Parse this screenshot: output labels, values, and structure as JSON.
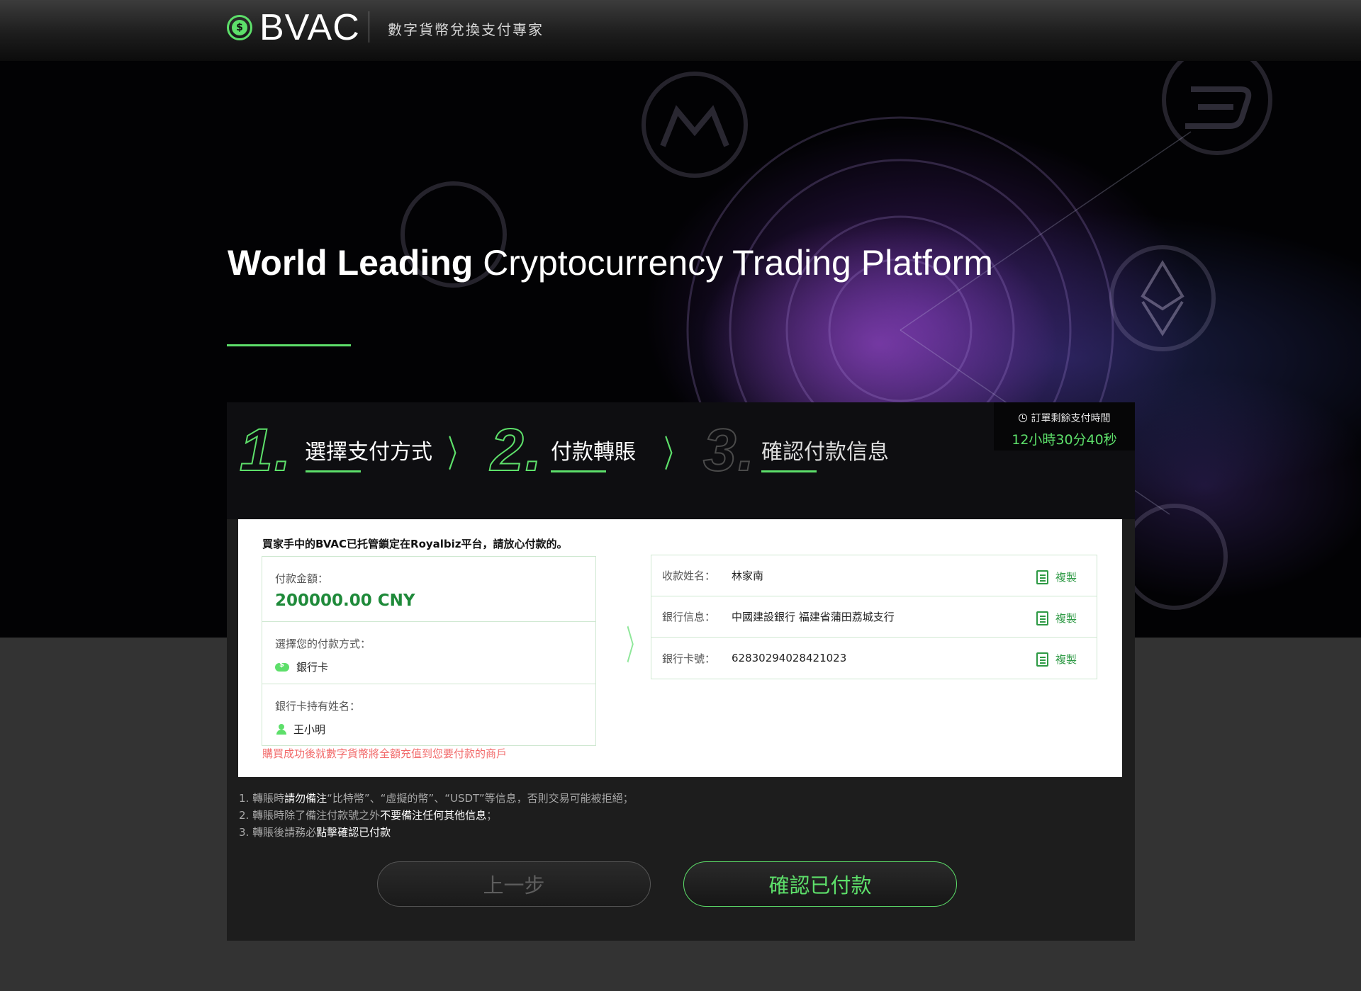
{
  "header": {
    "brand": "BVAC",
    "tagline": "數字貨幣兌換支付專家"
  },
  "hero": {
    "title_bold": "World Leading",
    "title_rest": "Cryptocurrency Trading Platform"
  },
  "steps": [
    {
      "num": "1.",
      "label": "選擇支付方式",
      "state": "done"
    },
    {
      "num": "2.",
      "label": "付款轉賬",
      "state": "active"
    },
    {
      "num": "3.",
      "label": "確認付款信息",
      "state": "pending"
    }
  ],
  "timer": {
    "label": "訂單剩餘支付時間",
    "value": "12小時30分40秒"
  },
  "card": {
    "notice": "買家手中的BVAC已托管鎖定在Royalbiz平台，請放心付款的。",
    "amount_label": "付款金額：",
    "amount_value": "200000.00 CNY",
    "method_label": "選擇您的付款方式：",
    "method_value": "銀行卡",
    "holder_label": "銀行卡持有姓名：",
    "holder_value": "王小明",
    "warning": "購買成功後就數字貨幣將全額充值到您要付款的商戶",
    "recipient": [
      {
        "label": "收款姓名：",
        "value": "林家南",
        "copy": "複製"
      },
      {
        "label": "銀行信息：",
        "value": "中國建設銀行 福建省蒲田荔城支行",
        "copy": "複製"
      },
      {
        "label": "銀行卡號：",
        "value": "62830294028421023",
        "copy": "複製"
      }
    ]
  },
  "instructions": {
    "l1_a": "1. 轉賬時",
    "l1_b": "請勿備注",
    "l1_c": "“比特幣”、“虛擬的幣”、“USDT”等信息，否則交易可能被拒絕；",
    "l2_a": "2. 轉賬時除了備注付款號之外",
    "l2_b": "不要備注任何其他信息",
    "l2_c": "；",
    "l3_a": "3. 轉賬後請務必",
    "l3_b": "點擊確認已付款"
  },
  "buttons": {
    "prev": "上一步",
    "confirm": "確認已付款"
  },
  "colors": {
    "accent": "#5ddf6a",
    "amount": "#1f8a3a",
    "warning": "#f26b6b",
    "page_bg": "#333333"
  }
}
